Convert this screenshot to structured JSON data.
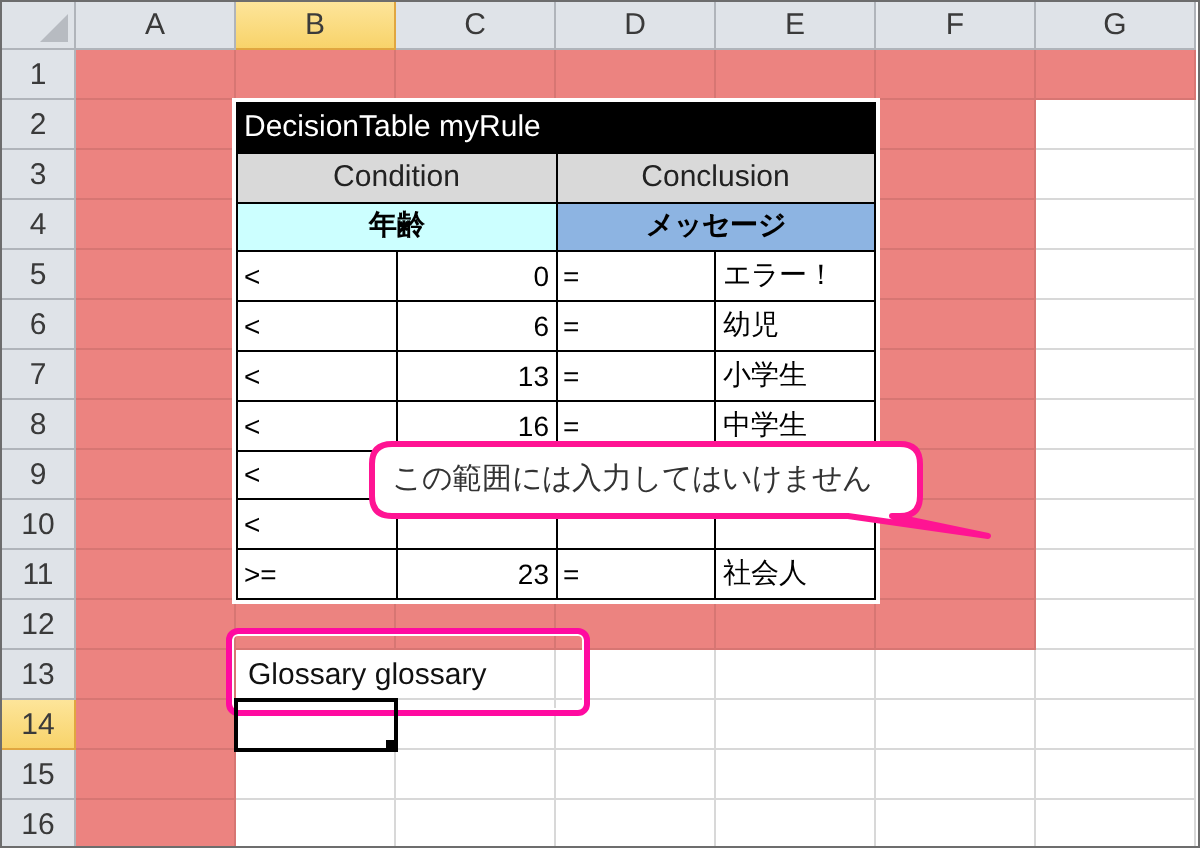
{
  "column_headers": [
    {
      "label": "A",
      "selected": false
    },
    {
      "label": "B",
      "selected": true
    },
    {
      "label": "C",
      "selected": false
    },
    {
      "label": "D",
      "selected": false
    },
    {
      "label": "E",
      "selected": false
    },
    {
      "label": "F",
      "selected": false
    },
    {
      "label": "G",
      "selected": false
    }
  ],
  "row_headers": [
    {
      "label": "1",
      "selected": false
    },
    {
      "label": "2",
      "selected": false
    },
    {
      "label": "3",
      "selected": false
    },
    {
      "label": "4",
      "selected": false
    },
    {
      "label": "5",
      "selected": false
    },
    {
      "label": "6",
      "selected": false
    },
    {
      "label": "7",
      "selected": false
    },
    {
      "label": "8",
      "selected": false
    },
    {
      "label": "9",
      "selected": false
    },
    {
      "label": "10",
      "selected": false
    },
    {
      "label": "11",
      "selected": false
    },
    {
      "label": "12",
      "selected": false
    },
    {
      "label": "13",
      "selected": false
    },
    {
      "label": "14",
      "selected": true
    },
    {
      "label": "15",
      "selected": false
    },
    {
      "label": "16",
      "selected": false
    }
  ],
  "decision_table": {
    "title": "DecisionTable myRule",
    "groups": [
      "Condition",
      "Conclusion"
    ],
    "fields": [
      "年齢",
      "メッセージ"
    ],
    "rows": [
      {
        "operator": "<",
        "value": "0",
        "equals": "=",
        "message": "エラー！"
      },
      {
        "operator": "<",
        "value": "6",
        "equals": "=",
        "message": "幼児"
      },
      {
        "operator": "<",
        "value": "13",
        "equals": "=",
        "message": "小学生"
      },
      {
        "operator": "<",
        "value": "16",
        "equals": "=",
        "message": "中学生"
      },
      {
        "operator": "<"
      },
      {
        "operator": "<"
      },
      {
        "operator": ">=",
        "value": "23",
        "equals": "=",
        "message": "社会人"
      }
    ]
  },
  "glossary_cell": {
    "text": "Glossary glossary"
  },
  "callout": {
    "text": "この範囲には入力してはいけません"
  }
}
